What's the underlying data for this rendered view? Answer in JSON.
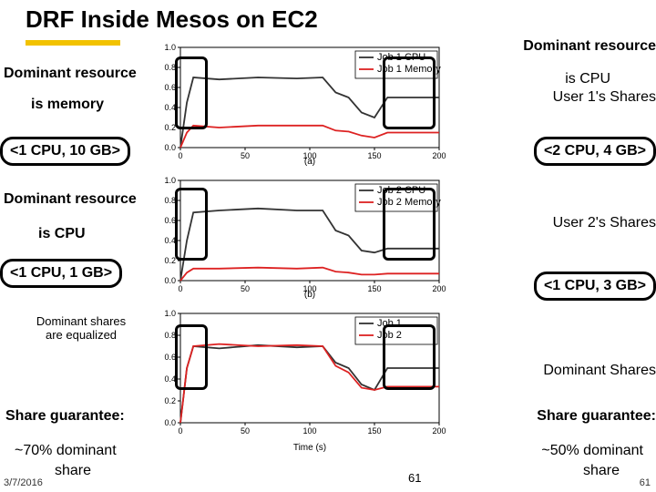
{
  "title": "DRF Inside Mesos on EC2",
  "left": {
    "dom_res_1": "Dominant resource",
    "is_memory": "is memory",
    "pill_1": "<1 CPU, 10 GB>",
    "dom_res_2": "Dominant resource",
    "is_cpu": "is CPU",
    "pill_2": "<1 CPU, 1 GB>",
    "dom_shares_eq": "Dominant shares\nare equalized",
    "share_g": "Share guarantee:",
    "seventy": "~70% dominant",
    "share_word": "share"
  },
  "right": {
    "dom_res": "Dominant resource",
    "is_cpu": "is CPU",
    "user1": "User 1's Shares",
    "pill_1": "<2 CPU, 4 GB>",
    "user2": "User 2's Shares",
    "pill_2": "<1 CPU, 3 GB>",
    "dom_shares": "Dominant Shares",
    "share_g": "Share guarantee:",
    "fifty": "~50% dominant",
    "share_word": "share"
  },
  "footer": {
    "date": "3/7/2016",
    "page_mid": "61",
    "page_right": "61"
  },
  "chart_data": [
    {
      "type": "line",
      "label": "(a)",
      "xlabel": "",
      "ylabel": "",
      "xlim": [
        0,
        200
      ],
      "ylim": [
        0.0,
        1.0
      ],
      "xticks": [
        0,
        50,
        100,
        150,
        200
      ],
      "yticks": [
        0.0,
        0.2,
        0.4,
        0.6,
        0.8,
        1.0
      ],
      "legend": [
        "Job 1 CPU",
        "Job 1 Memory"
      ],
      "series": [
        {
          "name": "Job 1 CPU",
          "x": [
            0,
            5,
            10,
            30,
            60,
            90,
            110,
            120,
            130,
            140,
            150,
            160,
            200
          ],
          "y": [
            0.0,
            0.45,
            0.7,
            0.68,
            0.7,
            0.69,
            0.7,
            0.55,
            0.5,
            0.35,
            0.3,
            0.5,
            0.5
          ]
        },
        {
          "name": "Job 1 Memory",
          "x": [
            0,
            5,
            10,
            30,
            60,
            90,
            110,
            120,
            130,
            140,
            150,
            160,
            200
          ],
          "y": [
            0.0,
            0.15,
            0.22,
            0.2,
            0.22,
            0.22,
            0.22,
            0.17,
            0.16,
            0.12,
            0.1,
            0.15,
            0.15
          ]
        }
      ]
    },
    {
      "type": "line",
      "label": "(b)",
      "xlabel": "",
      "ylabel": "",
      "xlim": [
        0,
        200
      ],
      "ylim": [
        0.0,
        1.0
      ],
      "xticks": [
        0,
        50,
        100,
        150,
        200
      ],
      "yticks": [
        0.0,
        0.2,
        0.4,
        0.6,
        0.8,
        1.0
      ],
      "legend": [
        "Job 2 CPU",
        "Job 2 Memory"
      ],
      "series": [
        {
          "name": "Job 2 CPU",
          "x": [
            0,
            5,
            10,
            30,
            60,
            90,
            110,
            120,
            130,
            140,
            150,
            160,
            200
          ],
          "y": [
            0.0,
            0.4,
            0.68,
            0.7,
            0.72,
            0.7,
            0.7,
            0.5,
            0.45,
            0.3,
            0.28,
            0.32,
            0.32
          ]
        },
        {
          "name": "Job 2 Memory",
          "x": [
            0,
            5,
            10,
            30,
            60,
            90,
            110,
            120,
            130,
            140,
            150,
            160,
            200
          ],
          "y": [
            0.0,
            0.08,
            0.12,
            0.12,
            0.13,
            0.12,
            0.13,
            0.09,
            0.08,
            0.06,
            0.06,
            0.07,
            0.07
          ]
        }
      ]
    },
    {
      "type": "line",
      "label": "",
      "xlabel": "Time (s)",
      "ylabel": "",
      "xlim": [
        0,
        200
      ],
      "ylim": [
        0.0,
        1.0
      ],
      "xticks": [
        0,
        50,
        100,
        150,
        200
      ],
      "yticks": [
        0.0,
        0.2,
        0.4,
        0.6,
        0.8,
        1.0
      ],
      "legend": [
        "Job 1",
        "Job 2"
      ],
      "series": [
        {
          "name": "Job 1",
          "x": [
            0,
            5,
            10,
            30,
            60,
            90,
            110,
            120,
            130,
            140,
            150,
            160,
            200
          ],
          "y": [
            0.0,
            0.5,
            0.7,
            0.68,
            0.71,
            0.69,
            0.7,
            0.55,
            0.5,
            0.35,
            0.3,
            0.5,
            0.5
          ]
        },
        {
          "name": "Job 2",
          "x": [
            0,
            5,
            10,
            30,
            60,
            90,
            110,
            120,
            130,
            140,
            150,
            160,
            200
          ],
          "y": [
            0.0,
            0.5,
            0.7,
            0.72,
            0.7,
            0.71,
            0.7,
            0.52,
            0.46,
            0.32,
            0.3,
            0.33,
            0.33
          ]
        }
      ]
    }
  ]
}
